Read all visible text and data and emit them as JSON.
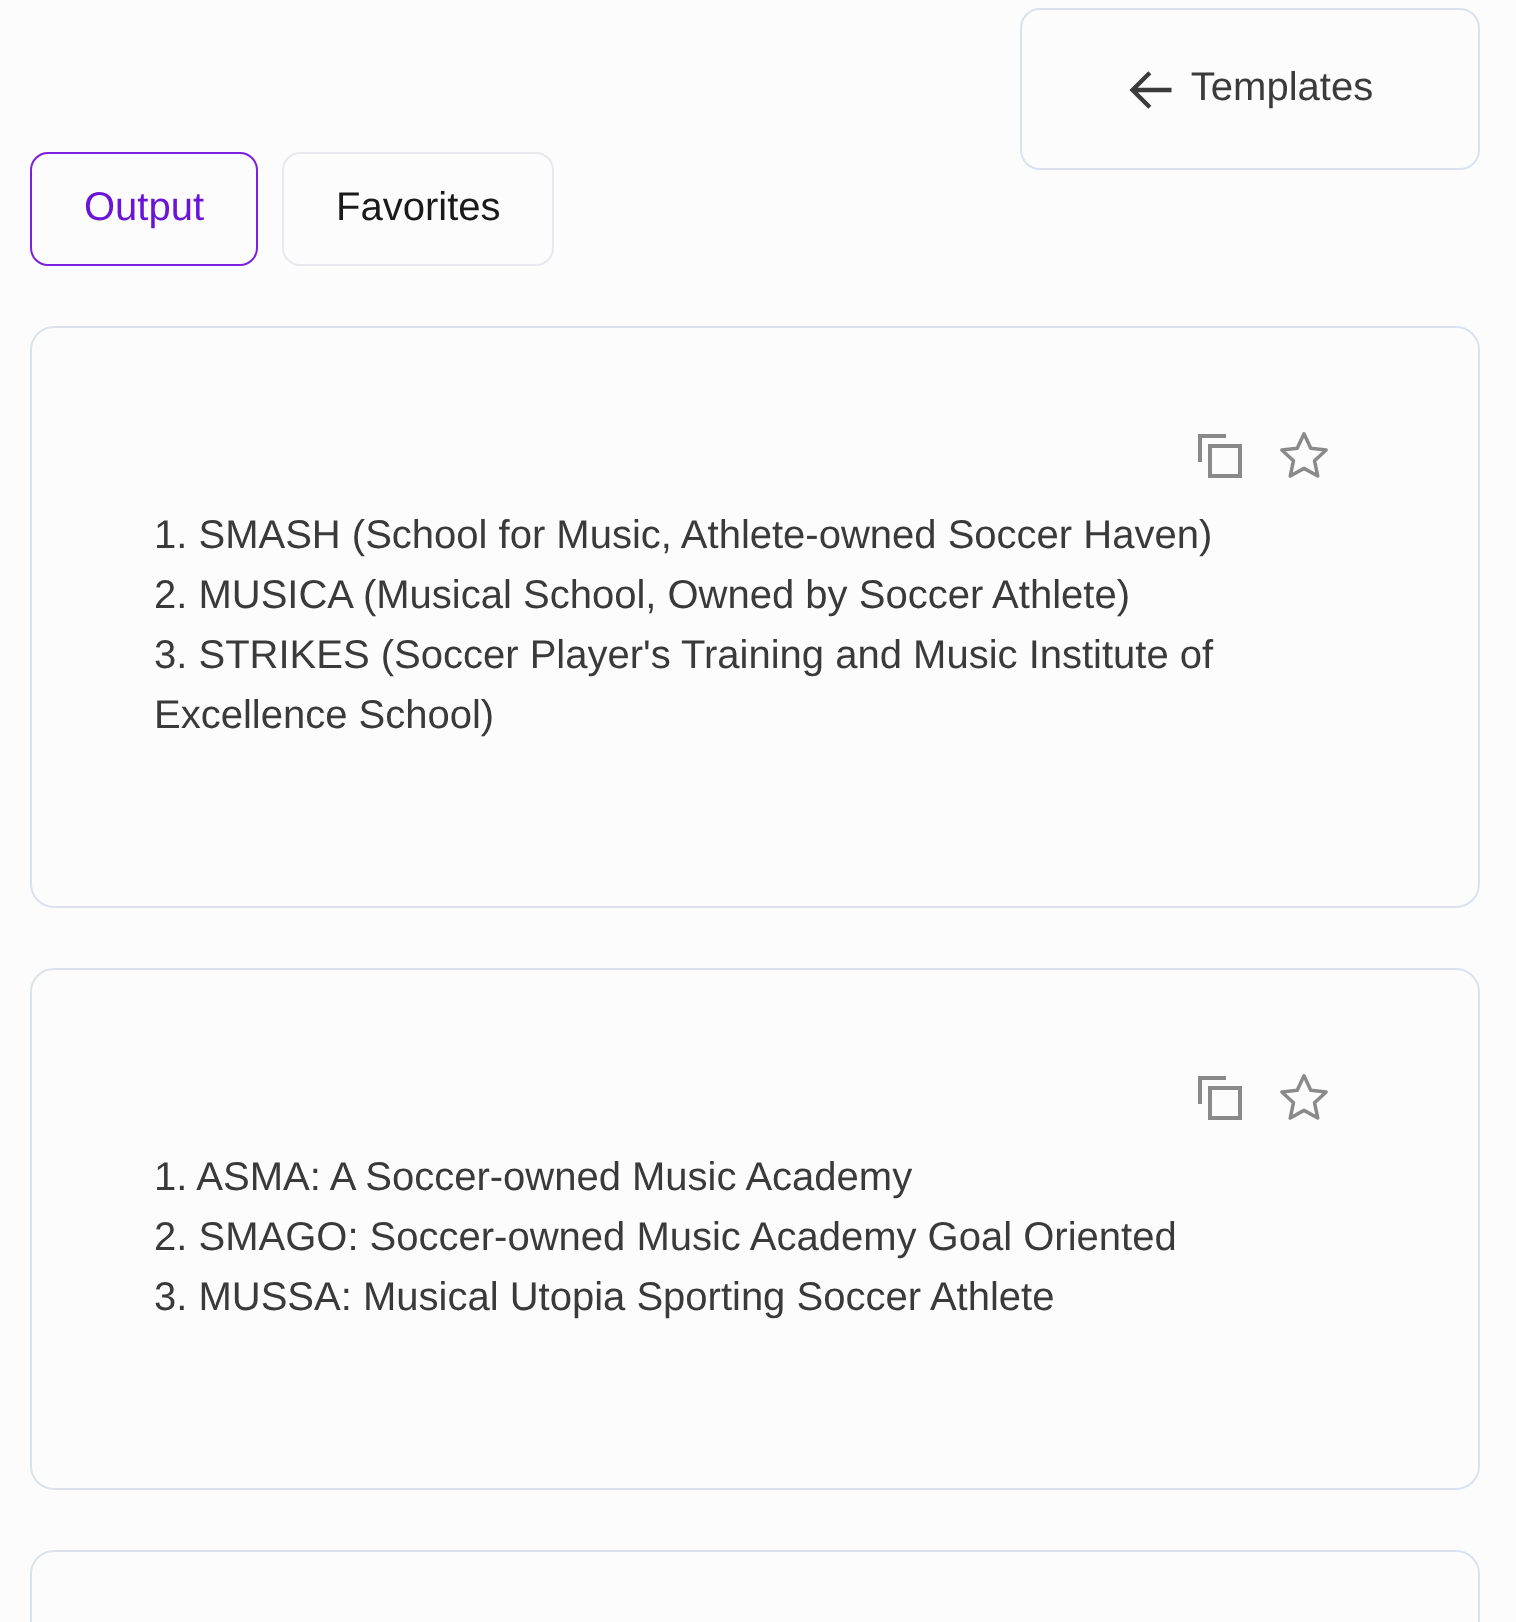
{
  "back_button": {
    "label": "Templates"
  },
  "tabs": [
    {
      "label": "Output",
      "selected": true
    },
    {
      "label": "Favorites",
      "selected": false
    }
  ],
  "cards": [
    {
      "kind": "result",
      "lines": [
        "1. SMASH (School for Music, Athlete-owned Soccer Haven)",
        "2. MUSICA (Musical School, Owned by Soccer Athlete)",
        "3. STRIKES (Soccer Player's Training and Music Institute of Excellence School)"
      ]
    },
    {
      "kind": "result",
      "lines": [
        "1. ASMA: A Soccer-owned Music Academy",
        "2. SMAGO: Soccer-owned Music Academy Goal Oriented",
        "3. MUSSA: Musical Utopia Sporting Soccer Athlete"
      ]
    },
    {
      "kind": "partial"
    }
  ]
}
